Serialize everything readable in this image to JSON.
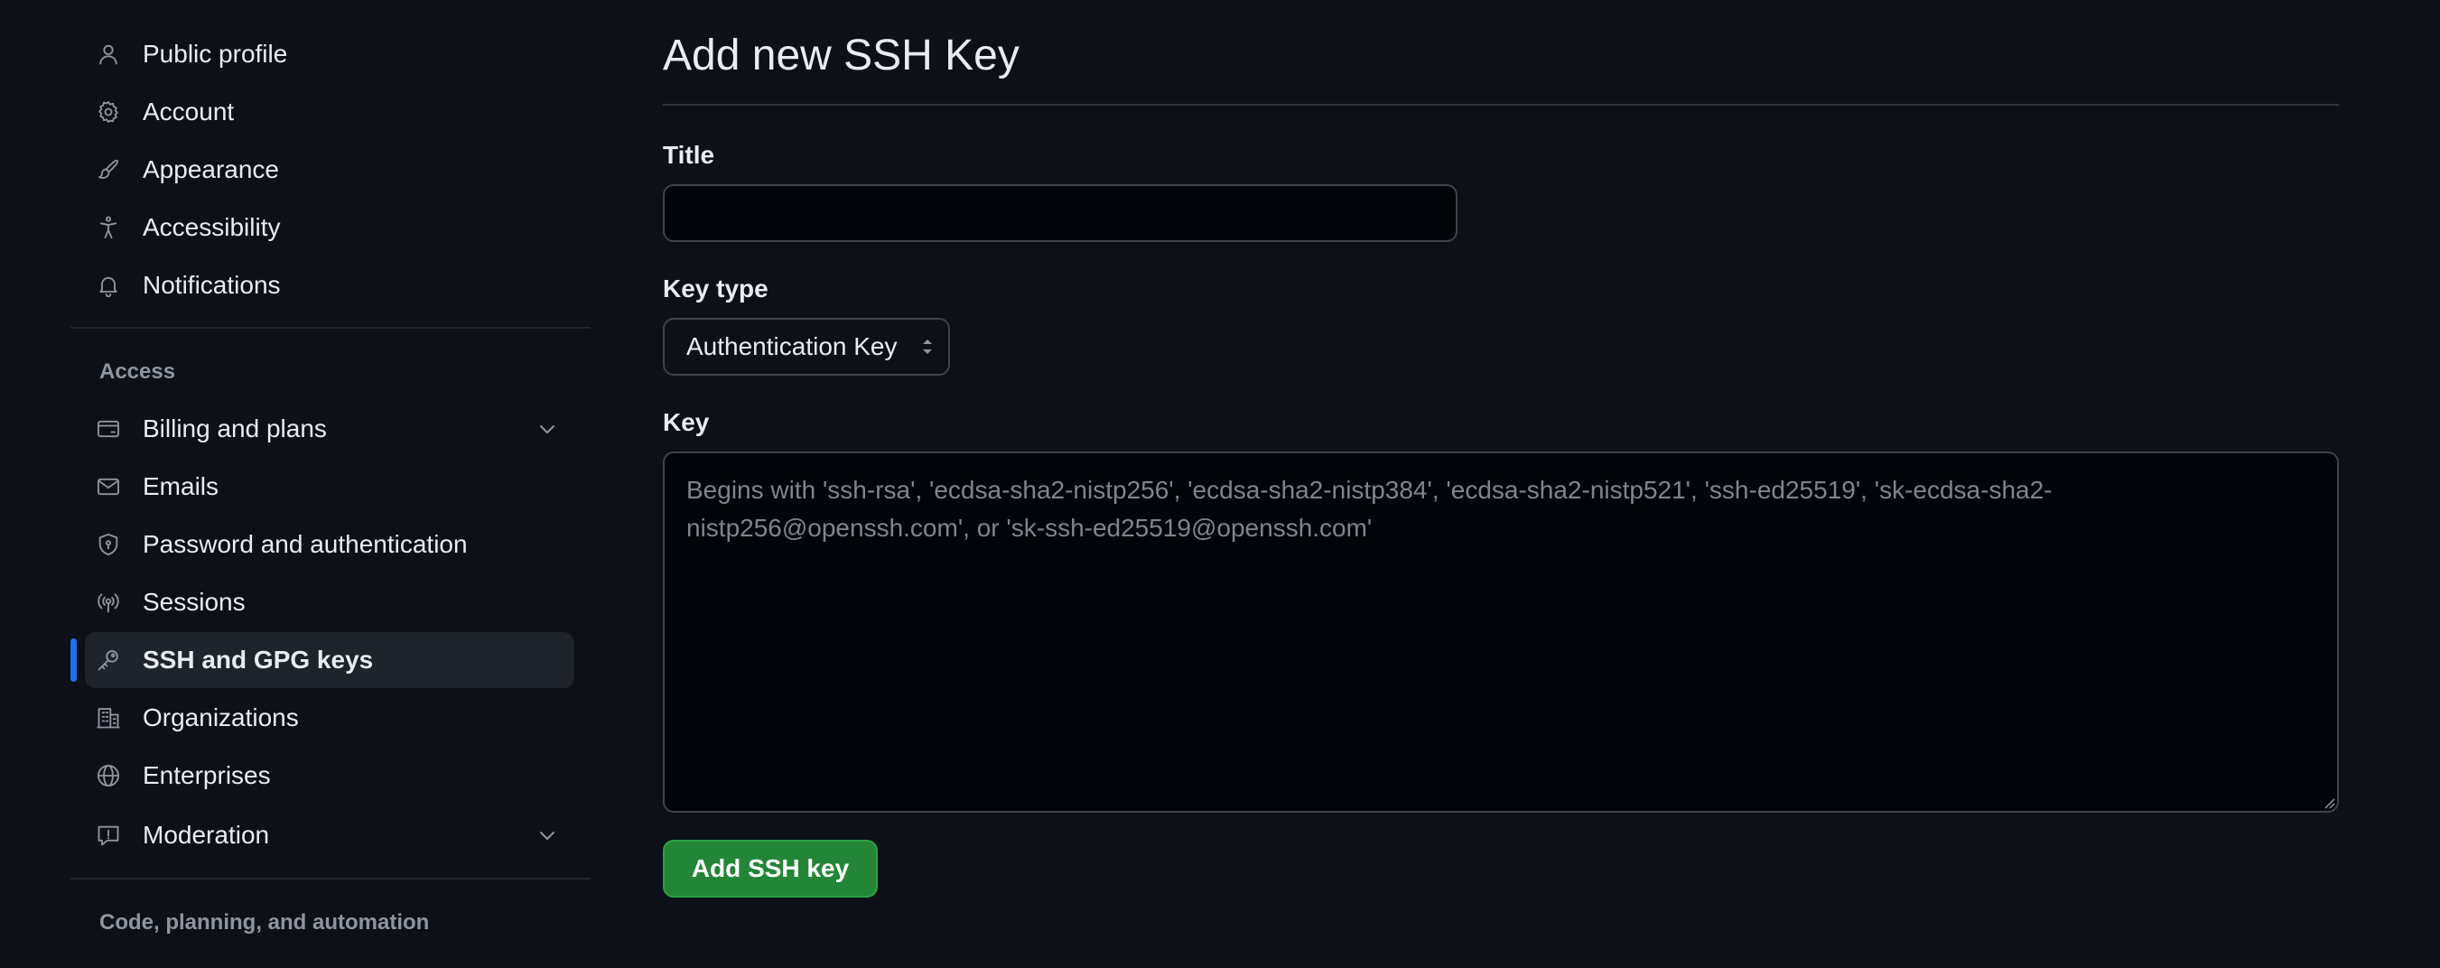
{
  "sidebar": {
    "items": [
      {
        "key": "public-profile",
        "label": "Public profile",
        "icon": "person-icon"
      },
      {
        "key": "account",
        "label": "Account",
        "icon": "gear-icon"
      },
      {
        "key": "appearance",
        "label": "Appearance",
        "icon": "paintbrush-icon"
      },
      {
        "key": "accessibility",
        "label": "Accessibility",
        "icon": "accessibility-icon"
      },
      {
        "key": "notifications",
        "label": "Notifications",
        "icon": "bell-icon"
      }
    ],
    "access_heading": "Access",
    "access_items": [
      {
        "key": "billing",
        "label": "Billing and plans",
        "icon": "credit-card-icon",
        "expandable": true
      },
      {
        "key": "emails",
        "label": "Emails",
        "icon": "mail-icon"
      },
      {
        "key": "password",
        "label": "Password and authentication",
        "icon": "shield-lock-icon"
      },
      {
        "key": "sessions",
        "label": "Sessions",
        "icon": "broadcast-icon"
      },
      {
        "key": "ssh-gpg",
        "label": "SSH and GPG keys",
        "icon": "key-icon",
        "active": true
      },
      {
        "key": "organizations",
        "label": "Organizations",
        "icon": "organization-icon"
      },
      {
        "key": "enterprises",
        "label": "Enterprises",
        "icon": "globe-icon"
      },
      {
        "key": "moderation",
        "label": "Moderation",
        "icon": "report-icon",
        "expandable": true
      }
    ],
    "code_heading": "Code, planning, and automation"
  },
  "main": {
    "title": "Add new SSH Key",
    "title_field": {
      "label": "Title",
      "value": "",
      "placeholder": ""
    },
    "key_type": {
      "label": "Key type",
      "selected": "Authentication Key"
    },
    "key_field": {
      "label": "Key",
      "value": "",
      "placeholder": "Begins with 'ssh-rsa', 'ecdsa-sha2-nistp256', 'ecdsa-sha2-nistp384', 'ecdsa-sha2-nistp521', 'ssh-ed25519', 'sk-ecdsa-sha2-nistp256@openssh.com', or 'sk-ssh-ed25519@openssh.com'"
    },
    "submit_label": "Add SSH key"
  },
  "colors": {
    "background": "#0d1117",
    "input_background": "#010409",
    "border": "#3d444d",
    "text": "#e6edf3",
    "muted_text": "#8d96a0",
    "active_indicator": "#1f6feb",
    "active_item_background": "#1f242c",
    "primary_button": "#238636"
  }
}
